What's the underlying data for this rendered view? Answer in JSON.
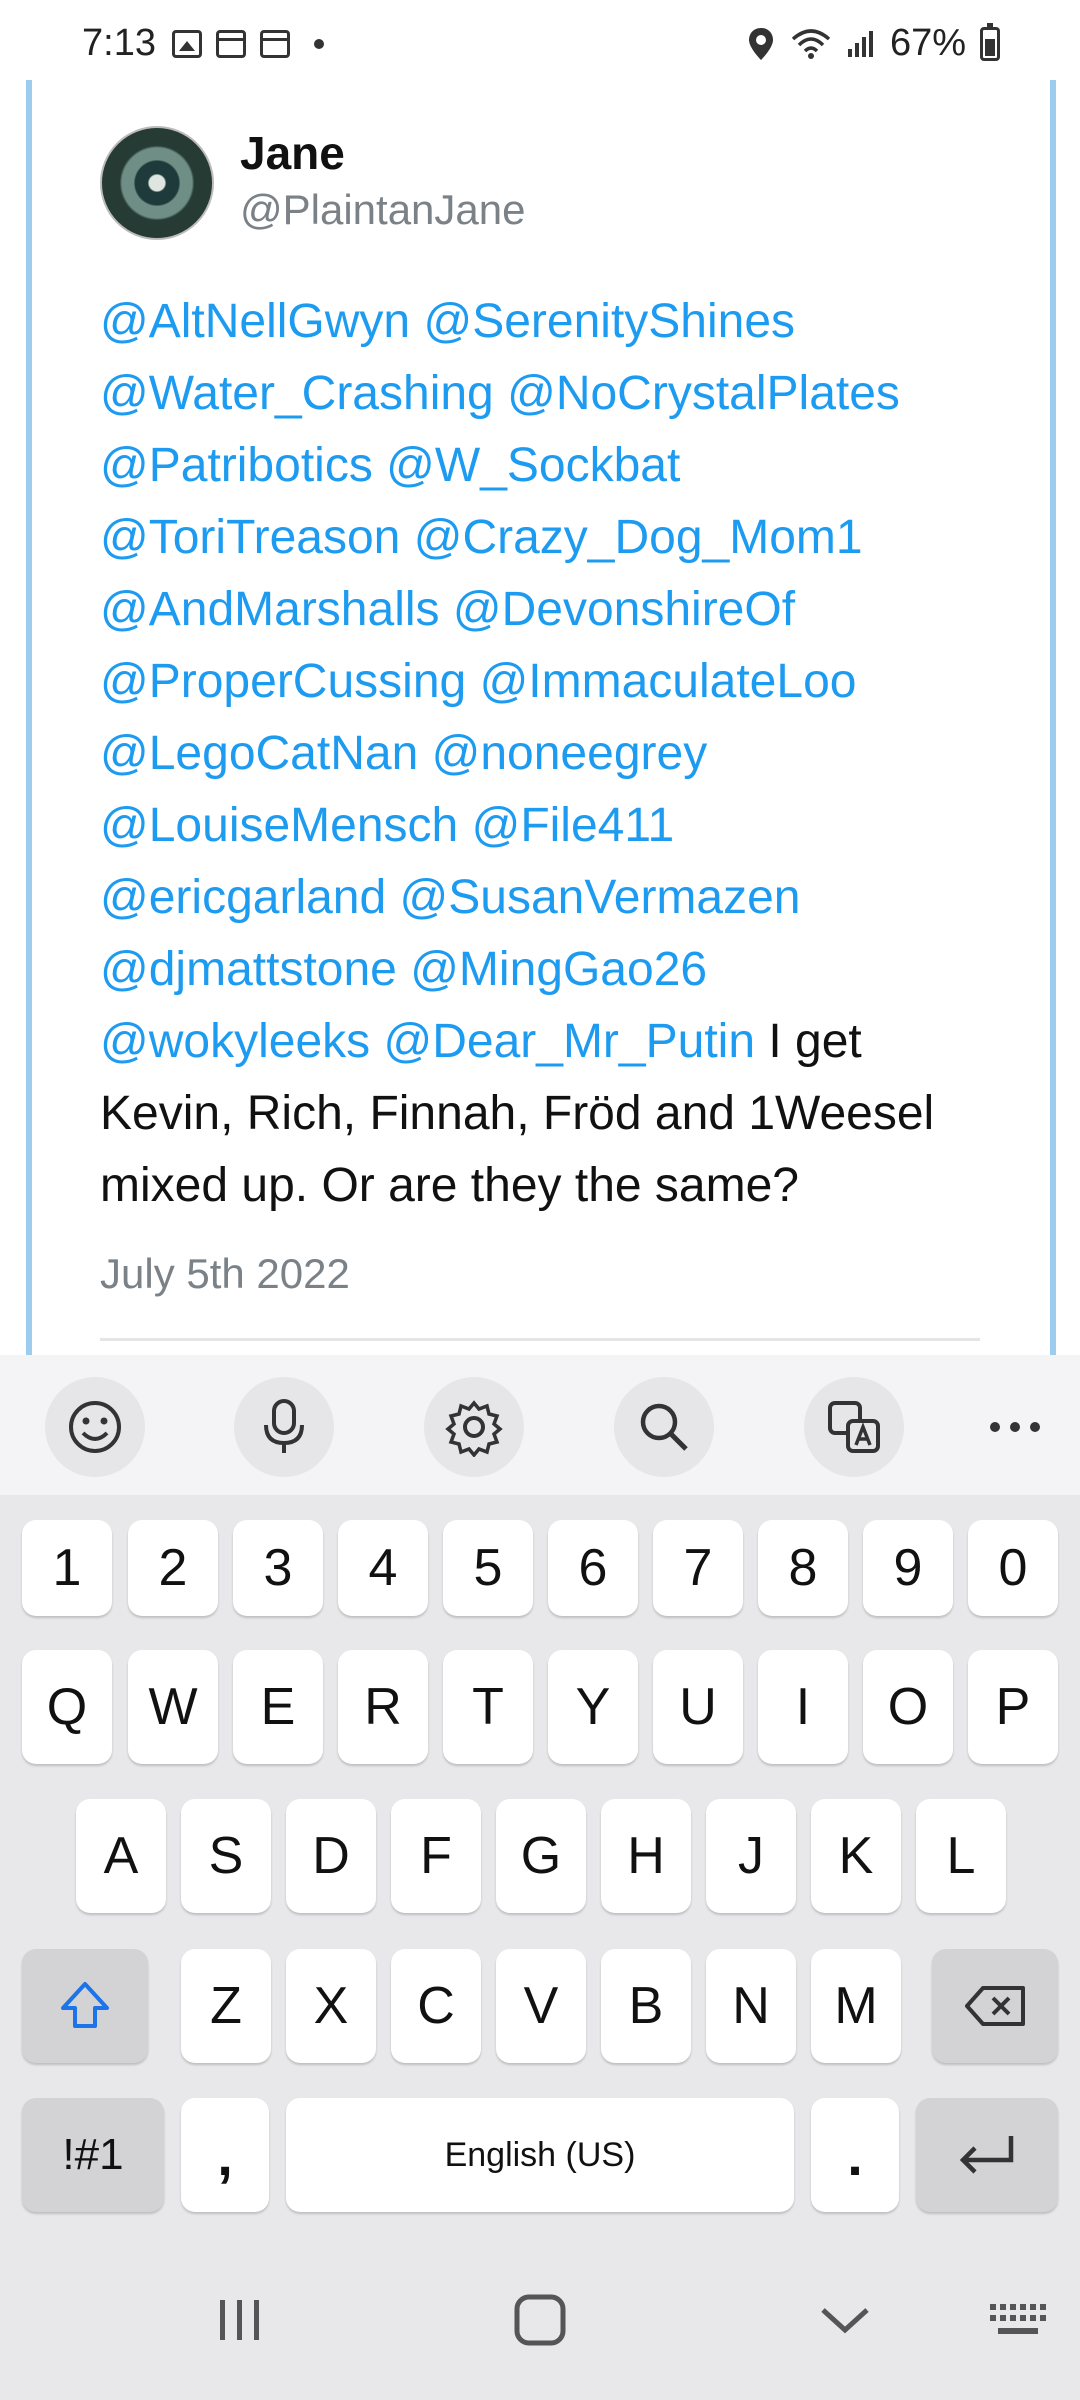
{
  "status_bar": {
    "time": "7:13",
    "battery": "67%"
  },
  "tweet": {
    "name": "Jane",
    "handle": "@PlaintanJane",
    "mentions": [
      "@AltNellGwyn",
      "@SerenityShines",
      "@Water_Crashing",
      "@NoCrystalPlates",
      "@Patribotics",
      "@W_Sockbat",
      "@ToriTreason",
      "@Crazy_Dog_Mom1",
      "@AndMarshalls",
      "@DevonshireOf",
      "@ProperCussing",
      "@ImmaculateLoo",
      "@LegoCatNan",
      "@noneegrey",
      "@LouiseMensch",
      "@File411",
      "@ericgarland",
      "@SusanVermazen",
      "@djmattstone",
      "@MingGao26",
      "@wokyleeks",
      "@Dear_Mr_Putin"
    ],
    "text_part1": "I get",
    "text_part2": "Kevin, Rich, Finnah, Fröd and 1Weesel",
    "text_part3": "mixed up. Or are they the same?",
    "date": "July 5th 2022"
  },
  "keyboard": {
    "number_row": [
      "1",
      "2",
      "3",
      "4",
      "5",
      "6",
      "7",
      "8",
      "9",
      "0"
    ],
    "row1": [
      "Q",
      "W",
      "E",
      "R",
      "T",
      "Y",
      "U",
      "I",
      "O",
      "P"
    ],
    "row2": [
      "A",
      "S",
      "D",
      "F",
      "G",
      "H",
      "J",
      "K",
      "L"
    ],
    "row3": [
      "Z",
      "X",
      "C",
      "V",
      "B",
      "N",
      "M"
    ],
    "symbols_key": "!#1",
    "comma_key": ",",
    "space_label": "English (US)",
    "period_key": "."
  },
  "colors": {
    "mention": "#1d9bf0",
    "accent_border": "#9ccdee",
    "keyboard_bg": "#e8e8ea"
  }
}
